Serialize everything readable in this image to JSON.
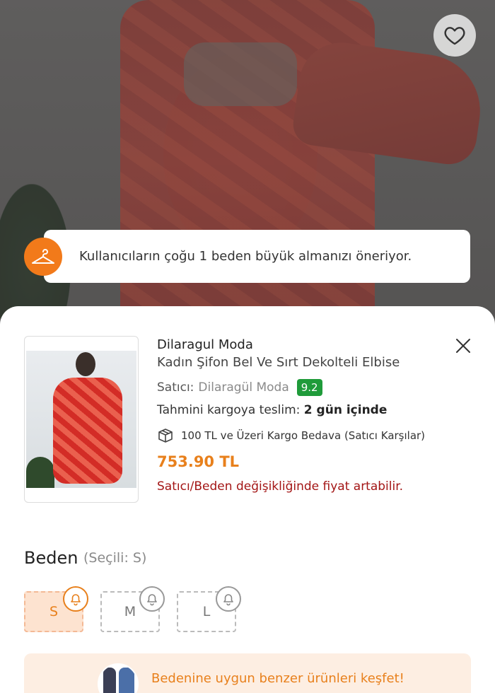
{
  "toast": {
    "text": "Kullanıcıların çoğu 1 beden büyük almanızı öneriyor.",
    "icon": "hanger-icon"
  },
  "product": {
    "seller_name": "Dilaragul Moda",
    "title": "Kadın Şifon Bel Ve Sırt Dekolteli Elbise",
    "seller_label": "Satıcı:",
    "seller_value": "Dilaragül Moda",
    "seller_score": "9.2",
    "delivery_label": "Tahmini kargoya teslim:",
    "delivery_value": "2 gün içinde",
    "cargo_text": "100 TL ve Üzeri Kargo Bedava (Satıcı Karşılar)",
    "price": "753.90 TL",
    "price_warning": "Satıcı/Beden değişikliğinde fiyat artabilir."
  },
  "size": {
    "title": "Beden",
    "selected_text": "(Seçili: S)",
    "options": [
      "S",
      "M",
      "L"
    ],
    "selected": "S"
  },
  "discover": {
    "text": "Bedenine uygun benzer ürünleri keşfet!"
  },
  "colors": {
    "accent": "#e8801c",
    "badge_green": "#1f9b3a",
    "warning_red": "#a31515"
  }
}
